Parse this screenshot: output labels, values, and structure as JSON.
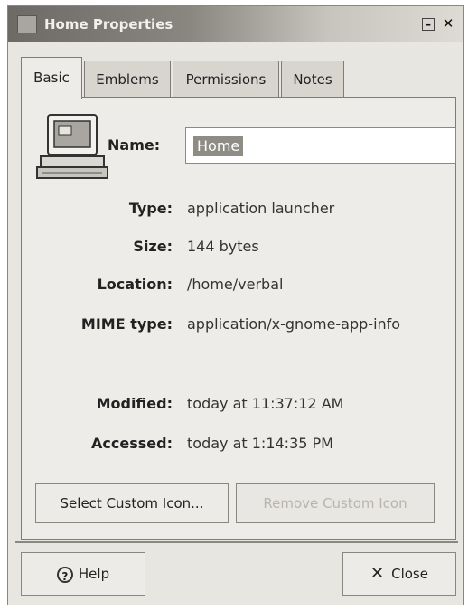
{
  "window": {
    "title": "Home Properties"
  },
  "tabs": [
    {
      "label": "Basic"
    },
    {
      "label": "Emblems"
    },
    {
      "label": "Permissions"
    },
    {
      "label": "Notes"
    }
  ],
  "name_field": {
    "label": "Name:",
    "value": "Home"
  },
  "properties": [
    {
      "label": "Type:",
      "value": "application launcher"
    },
    {
      "label": "Size:",
      "value": "144 bytes"
    },
    {
      "label": "Location:",
      "value": "/home/verbal"
    },
    {
      "label": "MIME type:",
      "value": "application/x-gnome-app-info"
    },
    {
      "label": "Modified:",
      "value": "today at 11:37:12 AM"
    },
    {
      "label": "Accessed:",
      "value": "today at 1:14:35 PM"
    }
  ],
  "buttons": {
    "select_icon": "Select Custom Icon...",
    "remove_icon": "Remove Custom Icon",
    "help": "Help",
    "close": "Close"
  }
}
